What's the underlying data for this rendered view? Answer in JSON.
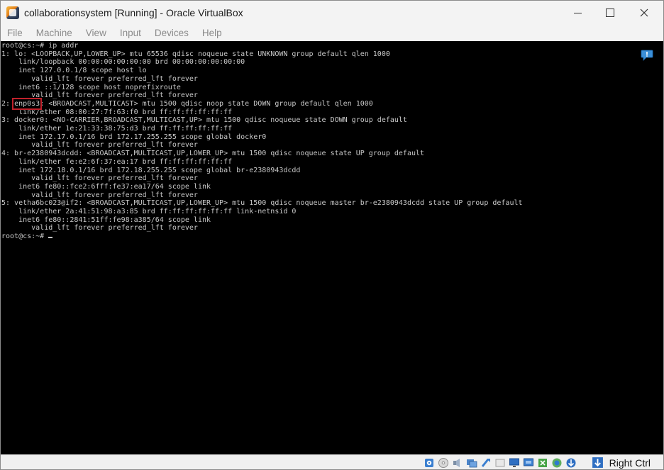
{
  "window": {
    "title": "collaborationsystem [Running] - Oracle VirtualBox",
    "icon": "virtualbox-app-icon"
  },
  "menu": {
    "items": [
      {
        "label": "File"
      },
      {
        "label": "Machine"
      },
      {
        "label": "View"
      },
      {
        "label": "Input"
      },
      {
        "label": "Devices"
      },
      {
        "label": "Help"
      }
    ]
  },
  "terminal": {
    "line_01": "root@cs:~# ip addr",
    "line_02": "1: lo: <LOOPBACK,UP,LOWER_UP> mtu 65536 qdisc noqueue state UNKNOWN group default qlen 1000",
    "line_03": "    link/loopback 00:00:00:00:00:00 brd 00:00:00:00:00:00",
    "line_04": "    inet 127.0.0.1/8 scope host lo",
    "line_05": "       valid_lft forever preferred_lft forever",
    "line_06": "    inet6 ::1/128 scope host noprefixroute",
    "line_07": "       valid_lft forever preferred_lft forever",
    "line_08_prefix": "2: ",
    "line_08_iface": "enp0s3",
    "line_08_rest": ": <BROADCAST,MULTICAST> mtu 1500 qdisc noop state DOWN group default qlen 1000",
    "line_09": "    link/ether 08:00:27:7f:63:f0 brd ff:ff:ff:ff:ff:ff",
    "line_10": "3: docker0: <NO-CARRIER,BROADCAST,MULTICAST,UP> mtu 1500 qdisc noqueue state DOWN group default",
    "line_11": "    link/ether 1e:21:33:38:75:d3 brd ff:ff:ff:ff:ff:ff",
    "line_12": "    inet 172.17.0.1/16 brd 172.17.255.255 scope global docker0",
    "line_13": "       valid_lft forever preferred_lft forever",
    "line_14": "4: br-e2380943dcdd: <BROADCAST,MULTICAST,UP,LOWER_UP> mtu 1500 qdisc noqueue state UP group default",
    "line_15": "    link/ether fe:e2:6f:37:ea:17 brd ff:ff:ff:ff:ff:ff",
    "line_16": "    inet 172.18.0.1/16 brd 172.18.255.255 scope global br-e2380943dcdd",
    "line_17": "       valid_lft forever preferred_lft forever",
    "line_18": "    inet6 fe80::fce2:6fff:fe37:ea17/64 scope link",
    "line_19": "       valid_lft forever preferred_lft forever",
    "line_20": "5: vetha6bc023@if2: <BROADCAST,MULTICAST,UP,LOWER_UP> mtu 1500 qdisc noqueue master br-e2380943dcdd state UP group default",
    "line_21": "    link/ether 2a:41:51:98:a3:85 brd ff:ff:ff:ff:ff:ff link-netnsid 0",
    "line_22": "    inet6 fe80::2841:51ff:fe98:a385/64 scope link",
    "line_23": "       valid_lft forever preferred_lft forever",
    "line_24": "root@cs:~# ",
    "highlight_color": "#c0212b",
    "background": "#000000",
    "foreground": "#c8c8c8"
  },
  "statusbar": {
    "host_key_label": "Right Ctrl",
    "icons": [
      "hard-disk-icon",
      "optical-drive-icon",
      "audio-icon",
      "network-icon",
      "usb-icon",
      "shared-folders-icon",
      "display-icon",
      "video-capture-icon",
      "recording-icon",
      "cpu-icon",
      "mouse-integration-icon",
      "keyboard-capture-icon"
    ]
  },
  "notification": {
    "icon": "notification-icon"
  }
}
